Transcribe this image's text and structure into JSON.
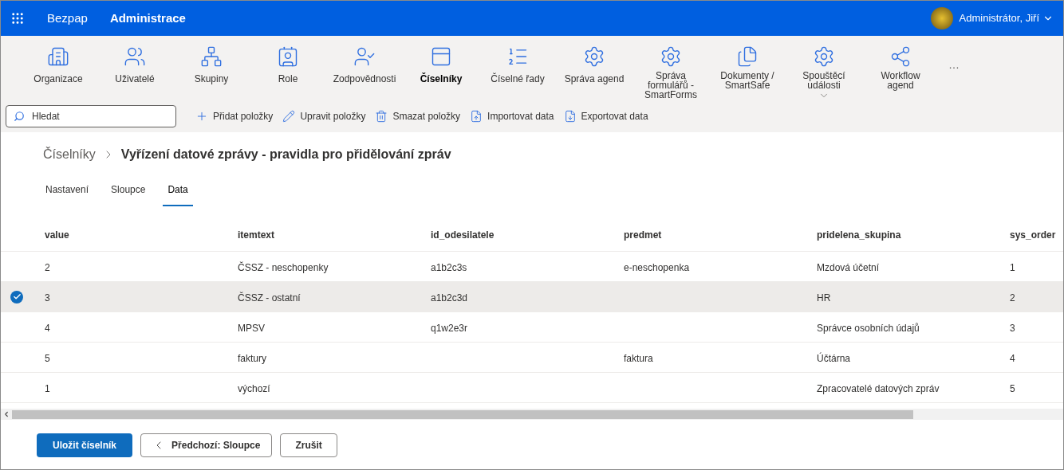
{
  "header": {
    "app": "Bezpap",
    "section": "Administrace",
    "user": "Administrátor, Jiří"
  },
  "ribbon": [
    {
      "kind": "building",
      "label": "Organizace",
      "selected": false
    },
    {
      "kind": "users",
      "label": "Uživatelé",
      "selected": false
    },
    {
      "kind": "groups",
      "label": "Skupiny",
      "selected": false
    },
    {
      "kind": "role",
      "label": "Role",
      "selected": false
    },
    {
      "kind": "usercheck",
      "label": "Zodpovědnosti",
      "selected": false
    },
    {
      "kind": "panel",
      "label": "Číselníky",
      "selected": true
    },
    {
      "kind": "list",
      "label": "Číselné řady",
      "selected": false
    },
    {
      "kind": "gearclip",
      "label": "Správa agend",
      "selected": false
    },
    {
      "kind": "gearform",
      "label": "Správa formulářů - SmartForms",
      "selected": false
    },
    {
      "kind": "files",
      "label": "Dokumenty / SmartSafe",
      "selected": false
    },
    {
      "kind": "gearplay",
      "label": "Spouštěcí události",
      "selected": false,
      "has_menu": true
    },
    {
      "kind": "share",
      "label": "Workflow agend",
      "selected": false
    },
    {
      "kind": "more",
      "label": "…"
    }
  ],
  "search": {
    "placeholder": "Hledat"
  },
  "actions": [
    {
      "kind": "add",
      "label": "Přidat položky"
    },
    {
      "kind": "edit",
      "label": "Upravit položky"
    },
    {
      "kind": "delete",
      "label": "Smazat položky"
    },
    {
      "kind": "import",
      "label": "Importovat data"
    },
    {
      "kind": "export",
      "label": "Exportovat data"
    }
  ],
  "breadcrumb": {
    "parent": "Číselníky",
    "current": "Vyřízení datové zprávy - pravidla pro přidělování zpráv"
  },
  "tabs": [
    {
      "label": "Nastavení",
      "selected": false
    },
    {
      "label": "Sloupce",
      "selected": false
    },
    {
      "label": "Data",
      "selected": true
    }
  ],
  "table": {
    "columns": [
      "value",
      "itemtext",
      "id_odesilatele",
      "predmet",
      "pridelena_skupina",
      "sys_order"
    ],
    "rows": [
      {
        "selected": false,
        "cells": [
          "2",
          "ČSSZ - neschopenky",
          "a1b2c3s",
          "e-neschopenka",
          "Mzdová účetní",
          "1"
        ]
      },
      {
        "selected": true,
        "cells": [
          "3",
          "ČSSZ - ostatní",
          "a1b2c3d",
          "",
          "HR",
          "2"
        ]
      },
      {
        "selected": false,
        "cells": [
          "4",
          "MPSV",
          "q1w2e3r",
          "",
          "Správce osobních údajů",
          "3"
        ]
      },
      {
        "selected": false,
        "cells": [
          "5",
          "faktury",
          "",
          "faktura",
          "Účtárna",
          "4"
        ]
      },
      {
        "selected": false,
        "cells": [
          "1",
          "výchozí",
          "",
          "",
          "Zpracovatelé datových zpráv",
          "5"
        ]
      }
    ]
  },
  "footer": {
    "save": "Uložit číselník",
    "previous": "Předchozí: Sloupce",
    "cancel": "Zrušit"
  }
}
